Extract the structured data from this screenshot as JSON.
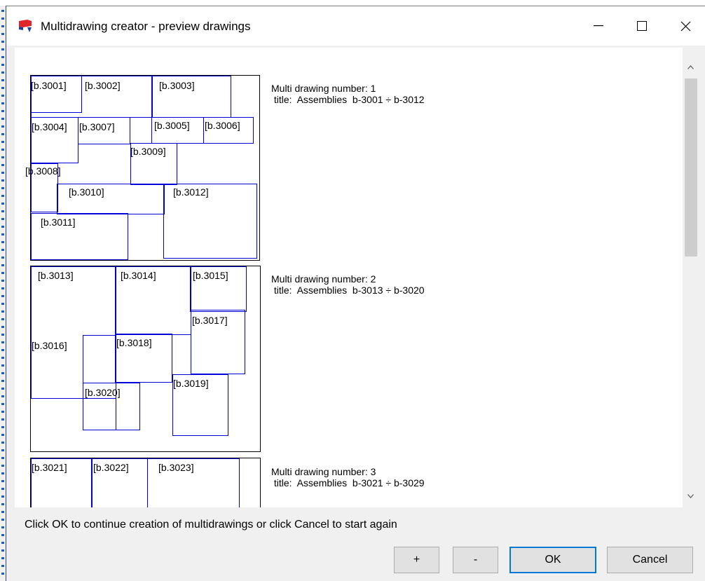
{
  "window": {
    "title": "Multidrawing creator - preview drawings",
    "app_icon": "red-flag-app-icon"
  },
  "controls": {
    "minimize_icon": "minimize-icon",
    "maximize_icon": "maximize-icon",
    "close_icon": "close-icon"
  },
  "colors": {
    "cell_border": "#0000dd",
    "default_button_border": "#0078d7",
    "app_icon_red": "#e0262b",
    "app_icon_blue": "#1f3f9a"
  },
  "drawings": [
    {
      "number_line": "Multi drawing number: 1",
      "title_line": " title:  Assemblies  b-3001 ÷ b-3012",
      "labels": [
        "[b.3001]",
        "[b.3002]",
        "[b.3003]",
        "[b.3004]",
        "[b.3007]",
        "[b.3005]",
        "[b.3006]",
        "[b.3009]",
        "[b.3008]",
        "[b.3010]",
        "[b.3012]",
        "[b.3011]"
      ]
    },
    {
      "number_line": "Multi drawing number: 2",
      "title_line": " title:  Assemblies  b-3013 ÷ b-3020",
      "labels": [
        "[b.3013]",
        "[b.3014]",
        "[b.3015]",
        "[b.3017]",
        "[b.3016]",
        "[b.3018]",
        "[b.3019]",
        "[b.3020]"
      ]
    },
    {
      "number_line": "Multi drawing number: 3",
      "title_line": " title:  Assemblies  b-3021 ÷ b-3029",
      "labels": [
        "[b.3021]",
        "[b.3022]",
        "[b.3023]"
      ]
    }
  ],
  "scrollbar": {
    "up_glyph": "^",
    "down_glyph": "v",
    "up_icon": "scroll-up-icon",
    "down_icon": "scroll-down-icon"
  },
  "instruction": "Click OK to continue creation of multidrawings or click Cancel to start again",
  "buttons": {
    "plus": "+",
    "minus": "-",
    "ok": "OK",
    "cancel": "Cancel"
  }
}
